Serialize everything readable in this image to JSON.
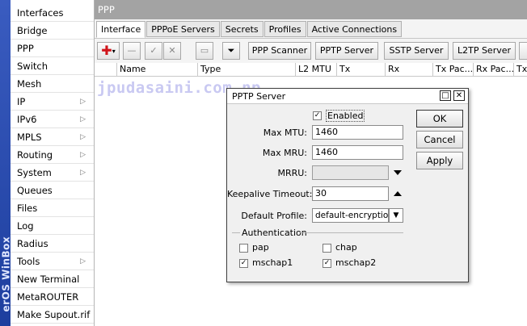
{
  "sidebar": {
    "brand": "erOS WinBox",
    "items": [
      {
        "label": "Interfaces",
        "submenu": false
      },
      {
        "label": "Bridge",
        "submenu": false
      },
      {
        "label": "PPP",
        "submenu": false
      },
      {
        "label": "Switch",
        "submenu": false
      },
      {
        "label": "Mesh",
        "submenu": false
      },
      {
        "label": "IP",
        "submenu": true
      },
      {
        "label": "IPv6",
        "submenu": true
      },
      {
        "label": "MPLS",
        "submenu": true
      },
      {
        "label": "Routing",
        "submenu": true
      },
      {
        "label": "System",
        "submenu": true
      },
      {
        "label": "Queues",
        "submenu": false
      },
      {
        "label": "Files",
        "submenu": false
      },
      {
        "label": "Log",
        "submenu": false
      },
      {
        "label": "Radius",
        "submenu": false
      },
      {
        "label": "Tools",
        "submenu": true
      },
      {
        "label": "New Terminal",
        "submenu": false
      },
      {
        "label": "MetaROUTER",
        "submenu": false
      },
      {
        "label": "Make Supout.rif",
        "submenu": false
      }
    ]
  },
  "window": {
    "title": "PPP",
    "tabs": [
      "Interface",
      "PPPoE Servers",
      "Secrets",
      "Profiles",
      "Active Connections"
    ],
    "active_tab": "Interface",
    "toolbar": {
      "ppp_scanner": "PPP Scanner",
      "pptp_server": "PPTP Server",
      "sstp_server": "SSTP Server",
      "l2tp_server": "L2TP Server"
    },
    "columns": [
      "Name",
      "Type",
      "L2 MTU",
      "Tx",
      "Rx",
      "Tx Pac...",
      "Rx Pac...",
      "Tx"
    ],
    "watermark": "jpudasaini.com.np"
  },
  "dialog": {
    "title": "PPTP Server",
    "enabled_label": "Enabled",
    "enabled": true,
    "max_mtu_label": "Max MTU:",
    "max_mtu": "1460",
    "max_mru_label": "Max MRU:",
    "max_mru": "1460",
    "mrru_label": "MRRU:",
    "mrru": "",
    "keepalive_label": "Keepalive Timeout:",
    "keepalive": "30",
    "default_profile_label": "Default Profile:",
    "default_profile": "default-encryption",
    "auth_group": "Authentication",
    "auth": [
      {
        "label": "pap",
        "checked": false
      },
      {
        "label": "chap",
        "checked": false
      },
      {
        "label": "mschap1",
        "checked": true
      },
      {
        "label": "mschap2",
        "checked": true
      }
    ],
    "buttons": {
      "ok": "OK",
      "cancel": "Cancel",
      "apply": "Apply"
    }
  },
  "colors": {
    "titlebar": "#a3a3a3",
    "brand_strip": "#2a4cb0",
    "add_icon": "#d0141a"
  }
}
